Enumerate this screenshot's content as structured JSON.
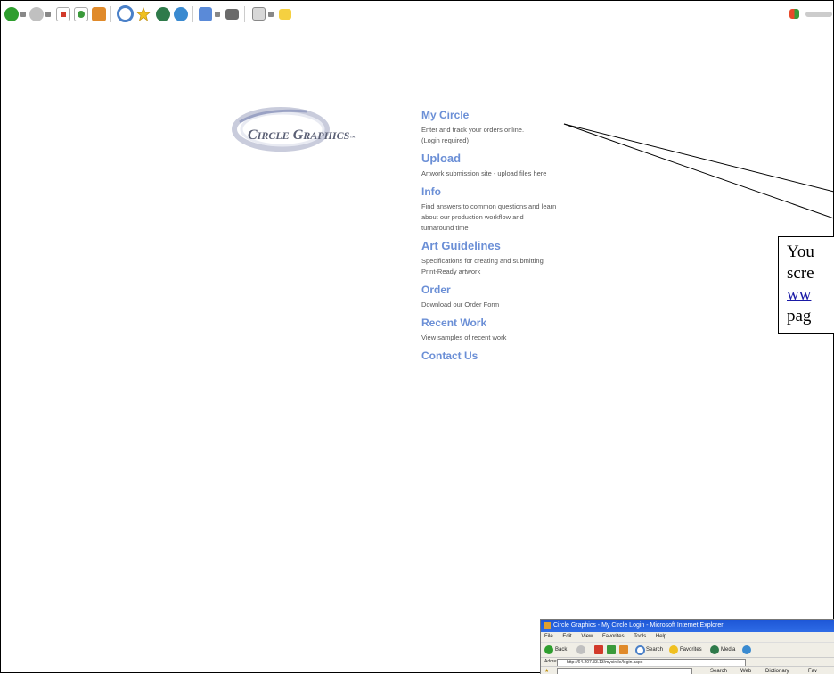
{
  "toolbar": {
    "icons": [
      "back-icon",
      "forward-icon",
      "stop-icon",
      "refresh-icon",
      "home-icon",
      "search-icon",
      "favorites-icon",
      "media-icon",
      "history-icon",
      "mail-icon",
      "print-icon",
      "edit-icon",
      "discuss-icon"
    ],
    "colors": {
      "back": "#2e9e2e",
      "forward": "#c0c0c0",
      "stop": "#d23a2a",
      "refresh": "#3a9a3a",
      "home": "#e08a2a",
      "search": "#4a80c8",
      "favorites": "#f0c020",
      "media": "#2e7a4a",
      "history": "#3a8ad0",
      "mail": "#5a8ad8",
      "print": "#6a6a6a",
      "edit": "#d8d8d8",
      "discuss": "#f5d040"
    }
  },
  "logo": {
    "text_part1_cap": "C",
    "text_part1_rest": "IRCLE",
    "text_part2_cap": "G",
    "text_part2_rest": "RAPHICS",
    "trademark": "™"
  },
  "menu": [
    {
      "title": "My Circle",
      "desc": [
        "Enter and track your orders online.",
        "(Login required)"
      ]
    },
    {
      "title": "Upload",
      "desc": [
        "Artwork submission site - upload files here"
      ]
    },
    {
      "title": "Info",
      "desc": [
        "Find answers to common questions and learn",
        "about our production workflow and",
        "turnaround time"
      ]
    },
    {
      "title": "Art Guidelines",
      "desc": [
        "Specifications for creating and submitting",
        "Print-Ready artwork"
      ]
    },
    {
      "title": "Order",
      "desc": [
        "Download our Order Form"
      ]
    },
    {
      "title": "Recent Work",
      "desc": [
        "View samples of recent work"
      ]
    },
    {
      "title": "Contact Us",
      "desc": []
    }
  ],
  "callout": {
    "line1": "You",
    "line2": "scre",
    "link": "ww",
    "line4": "pag"
  },
  "screenshot": {
    "title": "Circle Graphics - My Circle Login - Microsoft Internet Explorer",
    "menu": [
      "File",
      "Edit",
      "View",
      "Favorites",
      "Tools",
      "Help"
    ],
    "back_label": "Back",
    "search_label": "Search",
    "favorites_label": "Favorites",
    "media_label": "Media",
    "address_label": "Address",
    "address_value": "http://64.207.33.13/mycircle/login.aspx",
    "links": [
      "Search",
      "Web",
      "Dictionary",
      "Fav"
    ]
  },
  "accent_color": "#6b8fd6"
}
